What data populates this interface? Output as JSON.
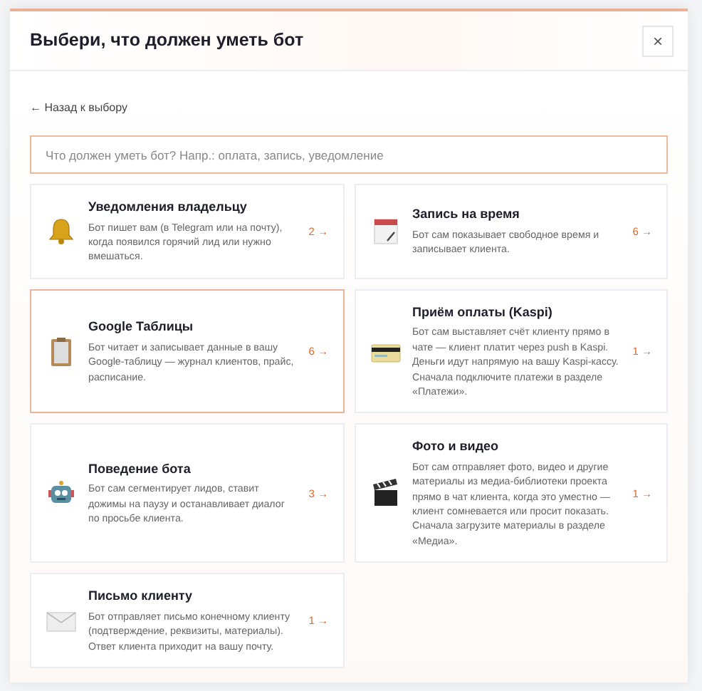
{
  "dialog": {
    "title": "Выбери, что должен уметь бот",
    "close": "×"
  },
  "back_link": "← Назад к выбору",
  "search": {
    "placeholder": "Что должен уметь бот? Напр.: оплата, запись, уведомление"
  },
  "capabilities": [
    {
      "title": "Уведомления владельцу",
      "description": "Бот пишет вам (в Telegram или на почту), когда появился горячий лид или нужно вмешаться.",
      "count": "2 →",
      "selected": false
    },
    {
      "title": "Запись на время",
      "description": "Бот сам показывает свободное время и записывает клиента.",
      "count": "6 →",
      "selected": false
    },
    {
      "title": "Google Таблицы",
      "description": "Бот читает и записывает данные в вашу Google-таблицу — журнал клиентов, прайс, расписание.",
      "count": "6 →",
      "selected": true
    },
    {
      "title": "Приём оплаты (Kaspi)",
      "description": "Бот сам выставляет счёт клиенту прямо в чате — клиент платит через push в Kaspi. Деньги идут напрямую на вашу Kaspi-кассу. Сначала подключите платежи в разделе «Платежи».",
      "count": "1 →",
      "selected": false
    },
    {
      "title": "Поведение бота",
      "description": "Бот сам сегментирует лидов, ставит дожимы на паузу и останавливает диалог по просьбе клиента.",
      "count": "3 →",
      "selected": false
    },
    {
      "title": "Фото и видео",
      "description": "Бот сам отправляет фото, видео и другие материалы из медиа-библиотеки проекта прямо в чат клиента, когда это уместно — клиент сомневается или просит показать. Сначала загрузите материалы в разделе «Медиа».",
      "count": "1 →",
      "selected": false
    },
    {
      "title": "Письмо клиенту",
      "description": "Бот отправляет письмо конечному клиенту (подтверждение, реквизиты, материалы). Ответ клиента приходит на вашу почту.",
      "count": "1 →",
      "selected": false
    }
  ]
}
